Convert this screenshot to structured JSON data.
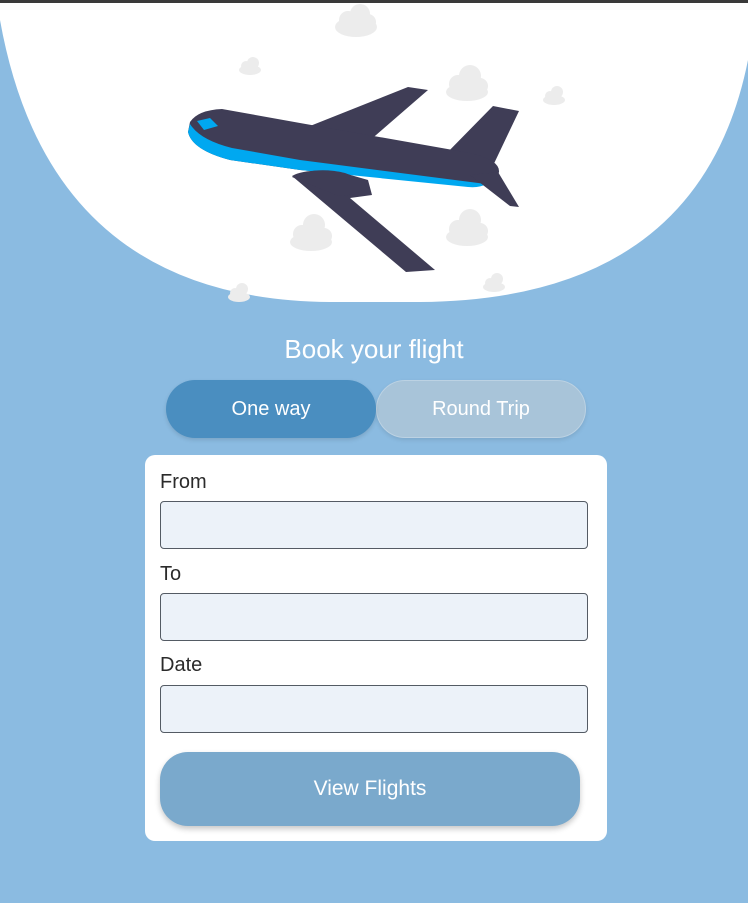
{
  "header": {
    "title": "Book your flight"
  },
  "trip_type": {
    "options": [
      {
        "label": "One way",
        "active": true
      },
      {
        "label": "Round Trip",
        "active": false
      }
    ]
  },
  "form": {
    "from": {
      "label": "From",
      "value": ""
    },
    "to": {
      "label": "To",
      "value": ""
    },
    "date": {
      "label": "Date",
      "value": ""
    },
    "submit_label": "View Flights"
  },
  "colors": {
    "background": "#8bbbe1",
    "active_toggle": "#4a8ec0",
    "inactive_toggle": "#a8c4d9",
    "submit_button": "#7aa9cc",
    "airplane_body": "#3f3d56",
    "airplane_stripe": "#00a8f0"
  },
  "illustration": {
    "icon": "airplane-icon"
  }
}
